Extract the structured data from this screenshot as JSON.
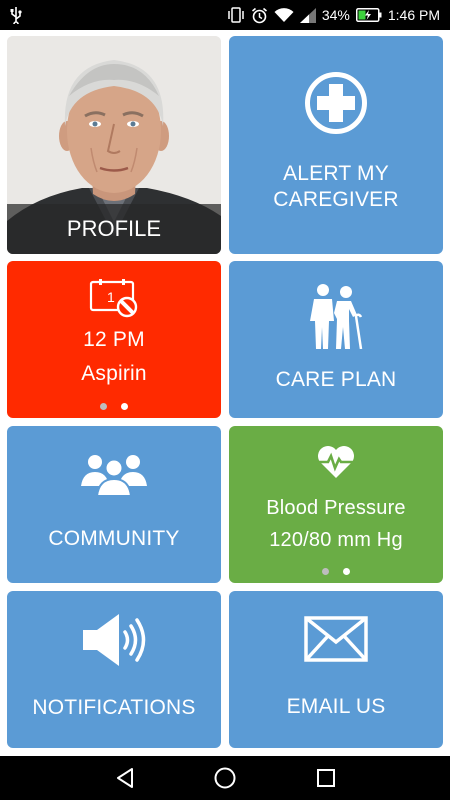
{
  "status_bar": {
    "battery_percent": "34%",
    "time": "1:46 PM",
    "icons": [
      "usb-icon",
      "vibrate-icon",
      "alarm-icon",
      "wifi-icon",
      "signal-icon",
      "battery-charging-icon"
    ]
  },
  "tiles": {
    "profile": {
      "label": "PROFILE"
    },
    "alert": {
      "label_line1": "ALERT MY",
      "label_line2": "CAREGIVER",
      "icon": "medical-cross-icon"
    },
    "medication": {
      "time": "12 PM",
      "name": "Aspirin",
      "icon": "pill-calendar-icon",
      "badge": "1",
      "pager_active_index": 1,
      "pager_count": 2
    },
    "care_plan": {
      "label": "CARE PLAN",
      "icon": "elderly-couple-icon"
    },
    "community": {
      "label": "COMMUNITY",
      "icon": "group-icon"
    },
    "vitals": {
      "title": "Blood Pressure",
      "value": "120/80 mm Hg",
      "icon": "heart-pulse-icon",
      "pager_active_index": 1,
      "pager_count": 2
    },
    "notifications": {
      "label": "NOTIFICATIONS",
      "icon": "speaker-icon"
    },
    "email": {
      "label": "EMAIL US",
      "icon": "envelope-icon"
    }
  },
  "colors": {
    "tile_blue": "#5b9bd5",
    "tile_red": "#ff2a00",
    "tile_green": "#6aad45"
  },
  "nav_bar": {
    "buttons": [
      "back-icon",
      "home-icon",
      "recents-icon"
    ]
  }
}
